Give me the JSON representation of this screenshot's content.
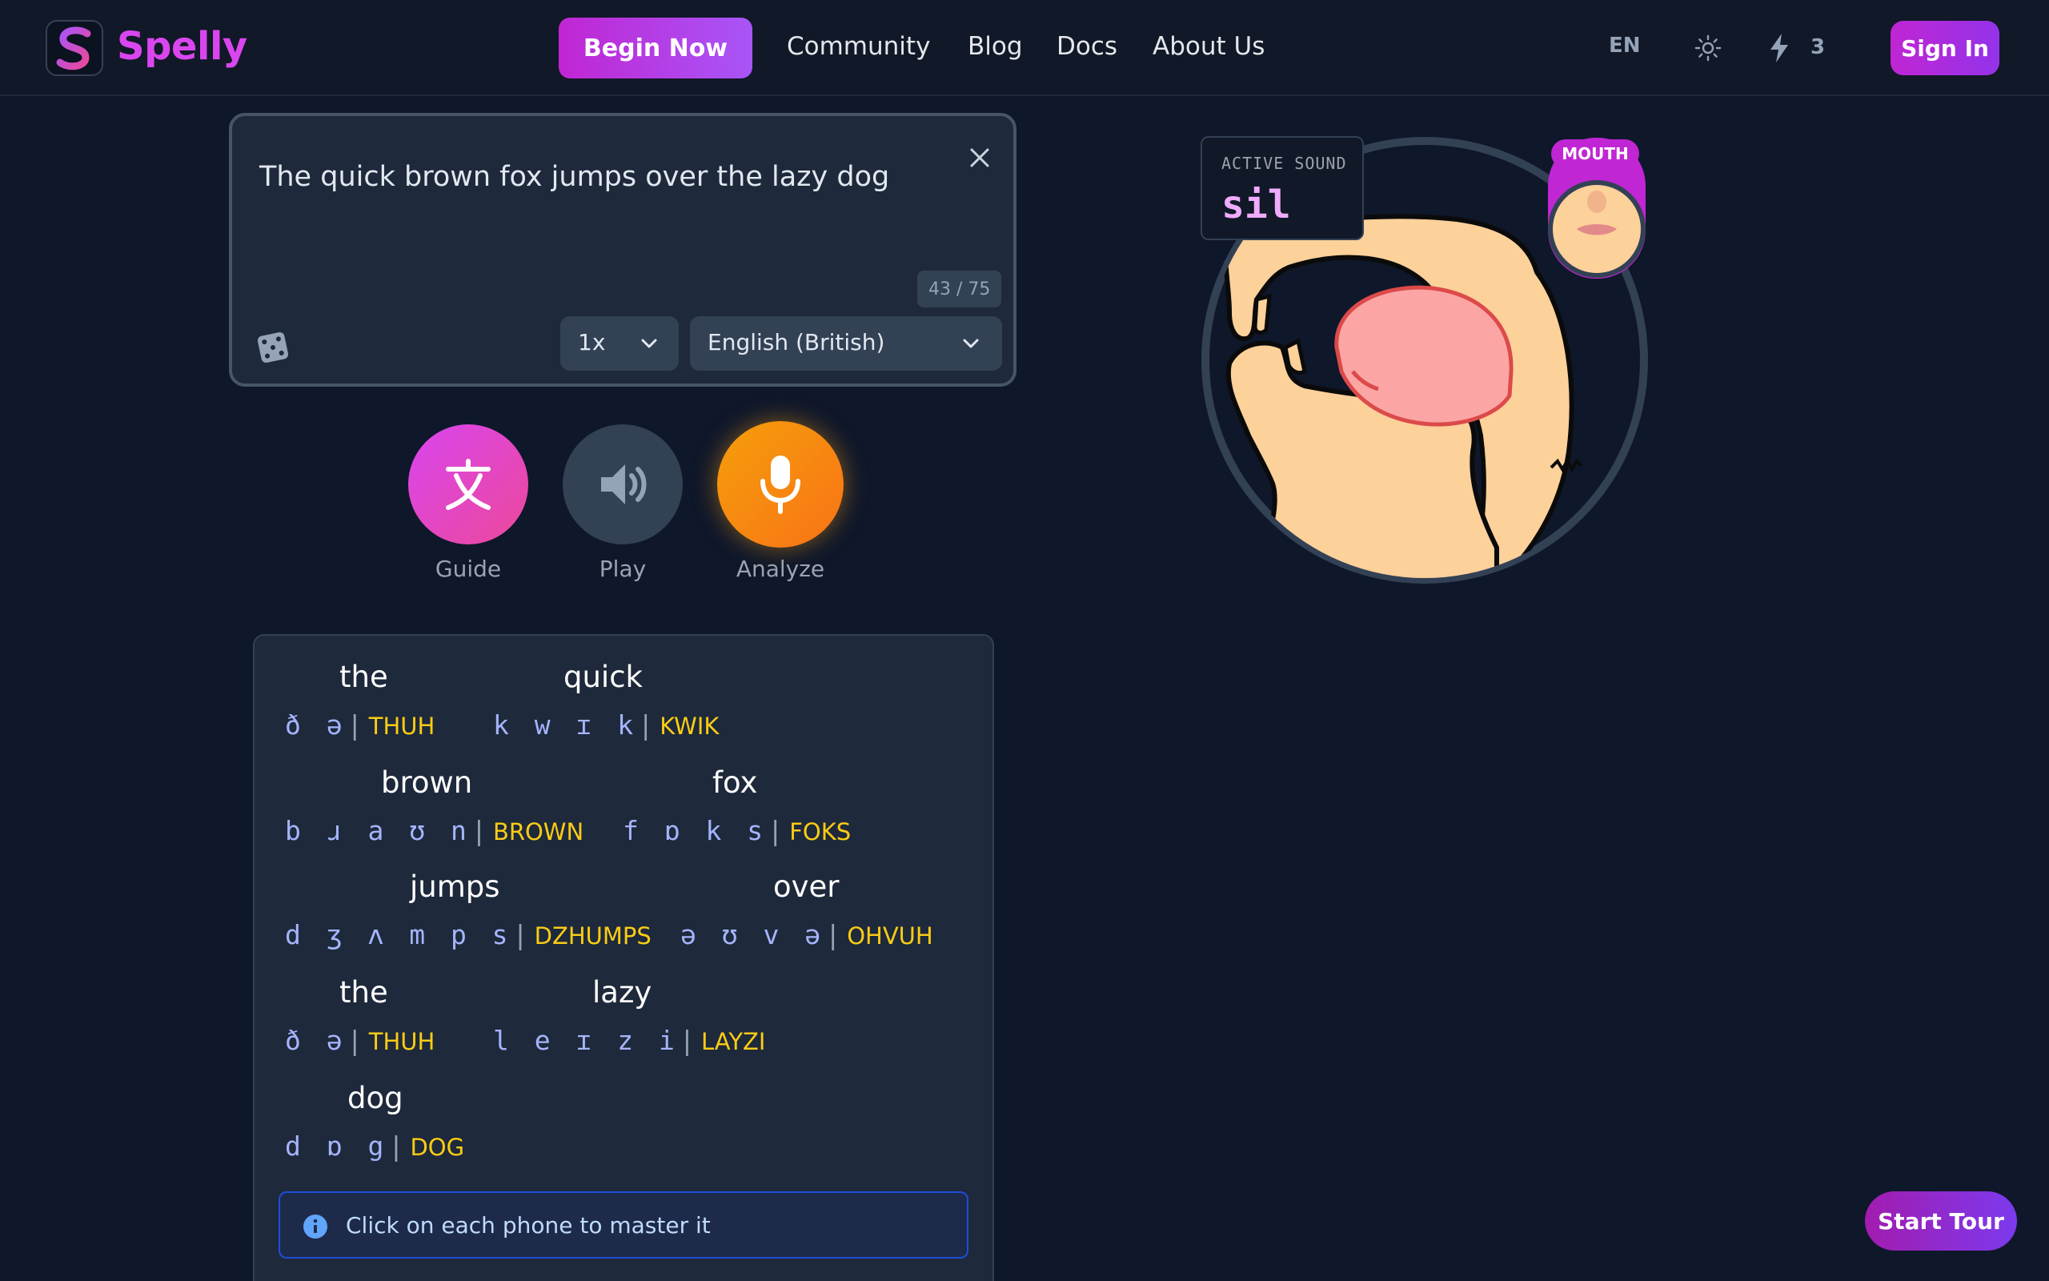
{
  "header": {
    "brand": "Spelly",
    "begin_label": "Begin Now",
    "nav": [
      "Community",
      "Blog",
      "Docs",
      "About Us"
    ],
    "language_code": "EN",
    "bolt_count": "3",
    "signin_label": "Sign In"
  },
  "editor": {
    "text": "The quick brown fox jumps over the lazy dog",
    "char_count": "43 / 75",
    "speed": "1x",
    "language": "English (British)"
  },
  "actions": {
    "guide": "Guide",
    "play": "Play",
    "analyze": "Analyze"
  },
  "phonetics": {
    "words": [
      {
        "word": "the",
        "ipa": "ð ə",
        "respell": "THUH"
      },
      {
        "word": "quick",
        "ipa": "k w ɪ k",
        "respell": "KWIK"
      },
      {
        "word": "brown",
        "ipa": "b ɹ a ʊ n",
        "respell": "BROWN"
      },
      {
        "word": "fox",
        "ipa": "f ɒ k s",
        "respell": "FOKS"
      },
      {
        "word": "jumps",
        "ipa": "d ʒ ʌ m p s",
        "respell": "DZHUMPS"
      },
      {
        "word": "over",
        "ipa": "ə ʊ v ə",
        "respell": "OHVUH"
      },
      {
        "word": "the",
        "ipa": "ð ə",
        "respell": "THUH"
      },
      {
        "word": "lazy",
        "ipa": "l e ɪ z i",
        "respell": "LAYZI"
      },
      {
        "word": "dog",
        "ipa": "d ɒ g",
        "respell": "DOG"
      }
    ],
    "hint": "Click on each phone to master it"
  },
  "articulation": {
    "active_label": "ACTIVE SOUND",
    "active_value": "sil",
    "badge": "MOUTH"
  },
  "tour_label": "Start Tour",
  "colors": {
    "background": "#0f172a",
    "accent": "#d946ef",
    "ipa": "#a5b4fc",
    "respelling": "#facc15",
    "analyze": "#f59e0b"
  }
}
